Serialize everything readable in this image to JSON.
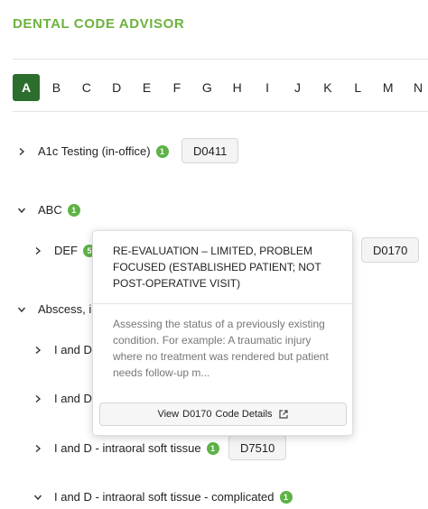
{
  "app_title": "DENTAL CODE ADVISOR",
  "letters": [
    "A",
    "B",
    "C",
    "D",
    "E",
    "F",
    "G",
    "H",
    "I",
    "J",
    "K",
    "L",
    "M",
    "N"
  ],
  "active_letter": "A",
  "entries": {
    "a1c": {
      "label": "A1c Testing (in-office)",
      "count": "1",
      "code": "D0411"
    },
    "abc": {
      "label": "ABC",
      "count": "1"
    },
    "def": {
      "label": "DEF",
      "count": "5",
      "code": "D0170"
    },
    "abscess": {
      "label": "Abscess, inc"
    },
    "id1": {
      "label": "I and D -"
    },
    "id2": {
      "label": "I and D -"
    },
    "id3": {
      "label": "I and D - intraoral soft tissue",
      "count": "1",
      "code": "D7510"
    },
    "id4": {
      "label": "I and D - intraoral soft tissue - complicated",
      "count": "1"
    }
  },
  "popover": {
    "title": "RE-EVALUATION – LIMITED, PROBLEM FOCUSED (ESTABLISHED PATIENT; NOT POST-OPERATIVE VISIT)",
    "description": "Assessing the status of a previously existing condition. For example: A traumatic injury where no treatment was rendered but patient needs follow-up m...",
    "button_prefix": "View",
    "button_code": "D0170",
    "button_suffix": "Code Details"
  }
}
